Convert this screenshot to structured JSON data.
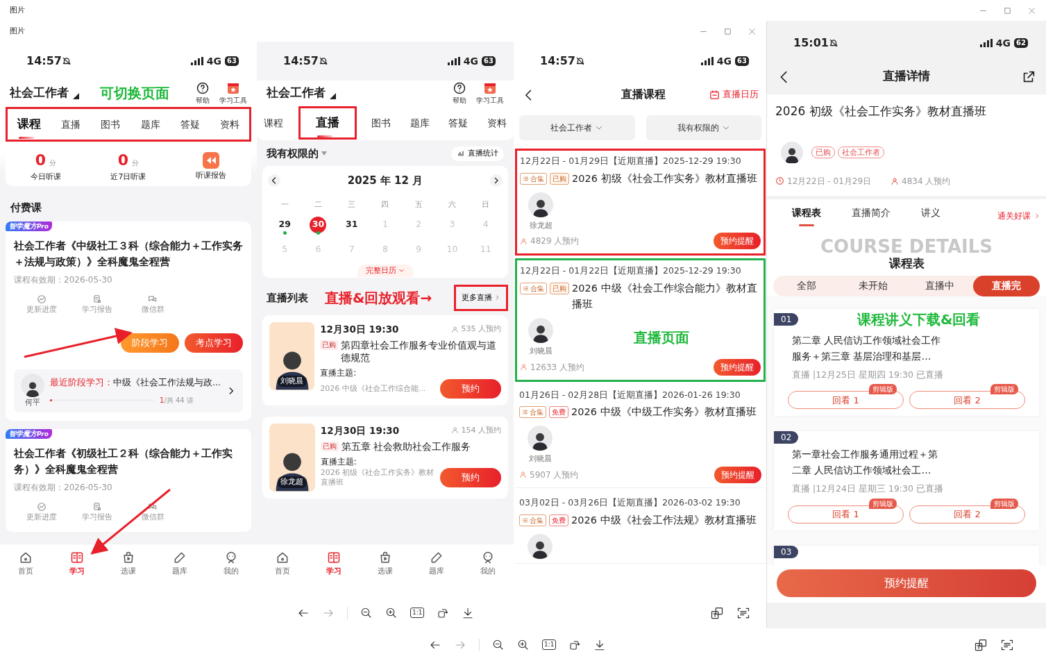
{
  "window": {
    "title": "图片",
    "toolbar": {
      "actual_size": "1:1"
    }
  },
  "inner_window": {
    "title": "图片",
    "toolbar": {
      "actual_size": "1:1"
    }
  },
  "screen_1": {
    "status_bar": {
      "time": "14:57",
      "network": "4G",
      "battery": "63"
    },
    "header": {
      "title": "社会工作者",
      "help": "帮助",
      "tools": "学习工具"
    },
    "annotation": "可切换页面",
    "tabs_highlighted": true,
    "tabs": [
      {
        "label": "课程",
        "selected": true
      },
      {
        "label": "直播",
        "selected": false
      },
      {
        "label": "图书",
        "selected": false
      },
      {
        "label": "题库",
        "selected": false
      },
      {
        "label": "答疑",
        "selected": false
      },
      {
        "label": "资料",
        "selected": false
      }
    ],
    "stats": [
      {
        "value": "0",
        "unit": "分",
        "label": "今日听课"
      },
      {
        "value": "0",
        "unit": "分",
        "label": "近7日听课"
      }
    ],
    "report": "听课报告",
    "section_title": "付费课",
    "courses": [
      {
        "badge": "智学魔方",
        "badge_pro": "Pro",
        "title": "社会工作者《中级社工３科（综合能力＋工作实务＋法规与政策）》全科魔鬼全程营",
        "validity": "课程有效期：2026-05-30",
        "actions": [
          "更新进度",
          "学习报告",
          "微信群"
        ],
        "buttons": [
          "阶段学习",
          "考点学习"
        ],
        "recent": {
          "teacher": "何平",
          "label": "最近阶段学习：",
          "course": "中级《社会工作法规与政...",
          "current": "1",
          "total": "/共 44 讲",
          "level": 0.02
        }
      },
      {
        "badge": "智学魔方",
        "badge_pro": "Pro",
        "title": "社会工作者《初级社工２科（综合能力＋工作实务）》全科魔鬼全程营",
        "validity": "课程有效期：2026-05-30",
        "actions": [
          "更新进度",
          "学习报告",
          "微信群"
        ]
      }
    ],
    "bottom_nav": [
      {
        "label": "首页",
        "selected": false
      },
      {
        "label": "学习",
        "selected": true
      },
      {
        "label": "选课",
        "selected": false
      },
      {
        "label": "题库",
        "selected": false
      },
      {
        "label": "我的",
        "selected": false
      }
    ]
  },
  "screen_2": {
    "status_bar": {
      "time": "14:57",
      "network": "4G",
      "battery": "63"
    },
    "header": {
      "title": "社会工作者",
      "help": "帮助",
      "tools": "学习工具"
    },
    "tabs": [
      {
        "label": "课程",
        "selected": false,
        "highlighted": false
      },
      {
        "label": "直播",
        "selected": true,
        "highlighted": true
      },
      {
        "label": "图书",
        "selected": false,
        "highlighted": false
      },
      {
        "label": "题库",
        "selected": false,
        "highlighted": false
      },
      {
        "label": "答疑",
        "selected": false,
        "highlighted": false
      },
      {
        "label": "资料",
        "selected": false,
        "highlighted": false
      }
    ],
    "filter": "我有权限的",
    "stats_button": "直播统计",
    "calendar": {
      "month": "2025 年 12 月",
      "weekdays": [
        "一",
        "二",
        "三",
        "四",
        "五",
        "六",
        "日"
      ],
      "weeks": [
        [
          {
            "day": "29",
            "muted": false,
            "dot": true,
            "selected": false
          },
          {
            "day": "30",
            "muted": false,
            "dot": true,
            "selected": true
          },
          {
            "day": "31",
            "muted": false,
            "dot": false,
            "selected": false
          },
          {
            "day": "1",
            "muted": true,
            "dot": false,
            "selected": false
          },
          {
            "day": "2",
            "muted": true,
            "dot": false,
            "selected": false
          },
          {
            "day": "3",
            "muted": true,
            "dot": false,
            "selected": false
          },
          {
            "day": "4",
            "muted": true,
            "dot": false,
            "selected": false
          }
        ],
        [
          {
            "day": "5",
            "muted": true,
            "dot": false,
            "selected": false
          },
          {
            "day": "6",
            "muted": true,
            "dot": false,
            "selected": false
          },
          {
            "day": "7",
            "muted": true,
            "dot": false,
            "selected": false
          },
          {
            "day": "8",
            "muted": true,
            "dot": false,
            "selected": false
          },
          {
            "day": "9",
            "muted": true,
            "dot": false,
            "selected": false
          },
          {
            "day": "10",
            "muted": true,
            "dot": false,
            "selected": false
          },
          {
            "day": "11",
            "muted": true,
            "dot": false,
            "selected": false
          }
        ]
      ],
      "full_calendar": "完整日历"
    },
    "list_title": "直播列表",
    "annotation": "直播&回放观看→",
    "more": {
      "label": "更多直播",
      "highlighted": true
    },
    "lives": [
      {
        "teacher": "刘晓晨",
        "time": "12月30日 19:30",
        "count": "535 人预约",
        "tag": "已购",
        "title": "第四章社会工作服务专业价值观与道德规范",
        "topic_label": "直播主题:",
        "topic": "2026 中级《社会工作综合能...",
        "button": "预约"
      },
      {
        "teacher": "徐龙超",
        "time": "12月30日 19:30",
        "count": "154 人预约",
        "tag": "已购",
        "title": "第五章 社会救助社会工作服务",
        "topic_label": "直播主题:",
        "topic": "2026 初级《社会工作实务》教材直播班",
        "button": "预约"
      }
    ],
    "bottom_nav": [
      {
        "label": "首页",
        "selected": false
      },
      {
        "label": "学习",
        "selected": true
      },
      {
        "label": "选课",
        "selected": false
      },
      {
        "label": "题库",
        "selected": false
      },
      {
        "label": "我的",
        "selected": false
      }
    ]
  },
  "screen_3": {
    "status_bar": {
      "time": "14:57",
      "network": "4G",
      "battery": "63"
    },
    "title": "直播课程",
    "calendar_link": "直播日历",
    "filters": [
      "社会工作者",
      "我有权限的"
    ],
    "annotation": "直播页面",
    "items": [
      {
        "range": "12月22日 - 01月29日【近期直播】2025-12-29 19:30",
        "tags": [
          {
            "kind": "collection",
            "label": "合集"
          },
          {
            "kind": "purchased",
            "label": "已购"
          }
        ],
        "title": "2026 初级《社会工作实务》教材直播班",
        "teacher": "徐龙超",
        "count": "4829 人预约",
        "button": "预约提醒",
        "color": "#e8202a"
      },
      {
        "range": "12月22日 - 01月22日【近期直播】2025-12-29 19:30",
        "tags": [
          {
            "kind": "collection",
            "label": "合集"
          },
          {
            "kind": "purchased",
            "label": "已购"
          }
        ],
        "title": "2026 中级《社会工作综合能力》教材直播班",
        "teacher": "刘晓晨",
        "count": "12633 人预约",
        "button": "预约提醒",
        "color": "#22b14c",
        "annotated": true
      },
      {
        "range": "01月26日 - 02月28日【近期直播】2026-01-26 19:30",
        "tags": [
          {
            "kind": "collection",
            "label": "合集"
          },
          {
            "kind": "free",
            "label": "免费"
          }
        ],
        "title": "2026 中级《中级工作实务》教材直播班",
        "teacher": "刘晓晨",
        "count": "5907 人预约",
        "button": "预约提醒"
      },
      {
        "range": "03月02日 - 03月26日【近期直播】2026-03-02 19:30",
        "tags": [
          {
            "kind": "collection",
            "label": "合集"
          },
          {
            "kind": "free",
            "label": "免费"
          }
        ],
        "title": "2026 中级《社会工作法规》教材直播班"
      }
    ]
  },
  "screen_4": {
    "status_bar": {
      "time": "15:01",
      "network": "4G",
      "battery": "62"
    },
    "title": "直播详情",
    "course_title": "2026 初级《社会工作实务》教材直播班",
    "tags": [
      "已购",
      "社会工作者"
    ],
    "date": "12月22日 - 01月29日",
    "count": "4834 人预约",
    "tabs": [
      {
        "label": "课程表",
        "selected": true
      },
      {
        "label": "直播简介",
        "selected": false
      },
      {
        "label": "讲义",
        "selected": false
      }
    ],
    "link": "通关好课",
    "banner_text": "COURSE DETAILS",
    "section_title": "课程表",
    "segments": [
      {
        "label": "全部",
        "selected": false
      },
      {
        "label": "未开始",
        "selected": false
      },
      {
        "label": "直播中",
        "selected": false
      },
      {
        "label": "直播完",
        "selected": true
      }
    ],
    "annotation": "课程讲义下载&回看",
    "lessons": [
      {
        "number": "01",
        "title": "第二章 人民信访工作领域社会工作服务＋第三章 基层治理和基层…",
        "meta": "直播 |12月25日 星期四 19:30 已直播",
        "replays": [
          {
            "label": "回看 1",
            "badge": "剪辑版"
          },
          {
            "label": "回看 2",
            "badge": "剪辑版"
          }
        ]
      },
      {
        "number": "02",
        "title": "第一章社会工作服务通用过程＋第二章 人民信访工作领域社会工…",
        "meta": "直播 |12月24日 星期三 19:30 已直播",
        "replays": [
          {
            "label": "回看 1",
            "badge": "剪辑版"
          },
          {
            "label": "回看 2",
            "badge": "剪辑版"
          }
        ]
      },
      {
        "number": "03"
      }
    ],
    "bottom_button": "预约提醒"
  }
}
